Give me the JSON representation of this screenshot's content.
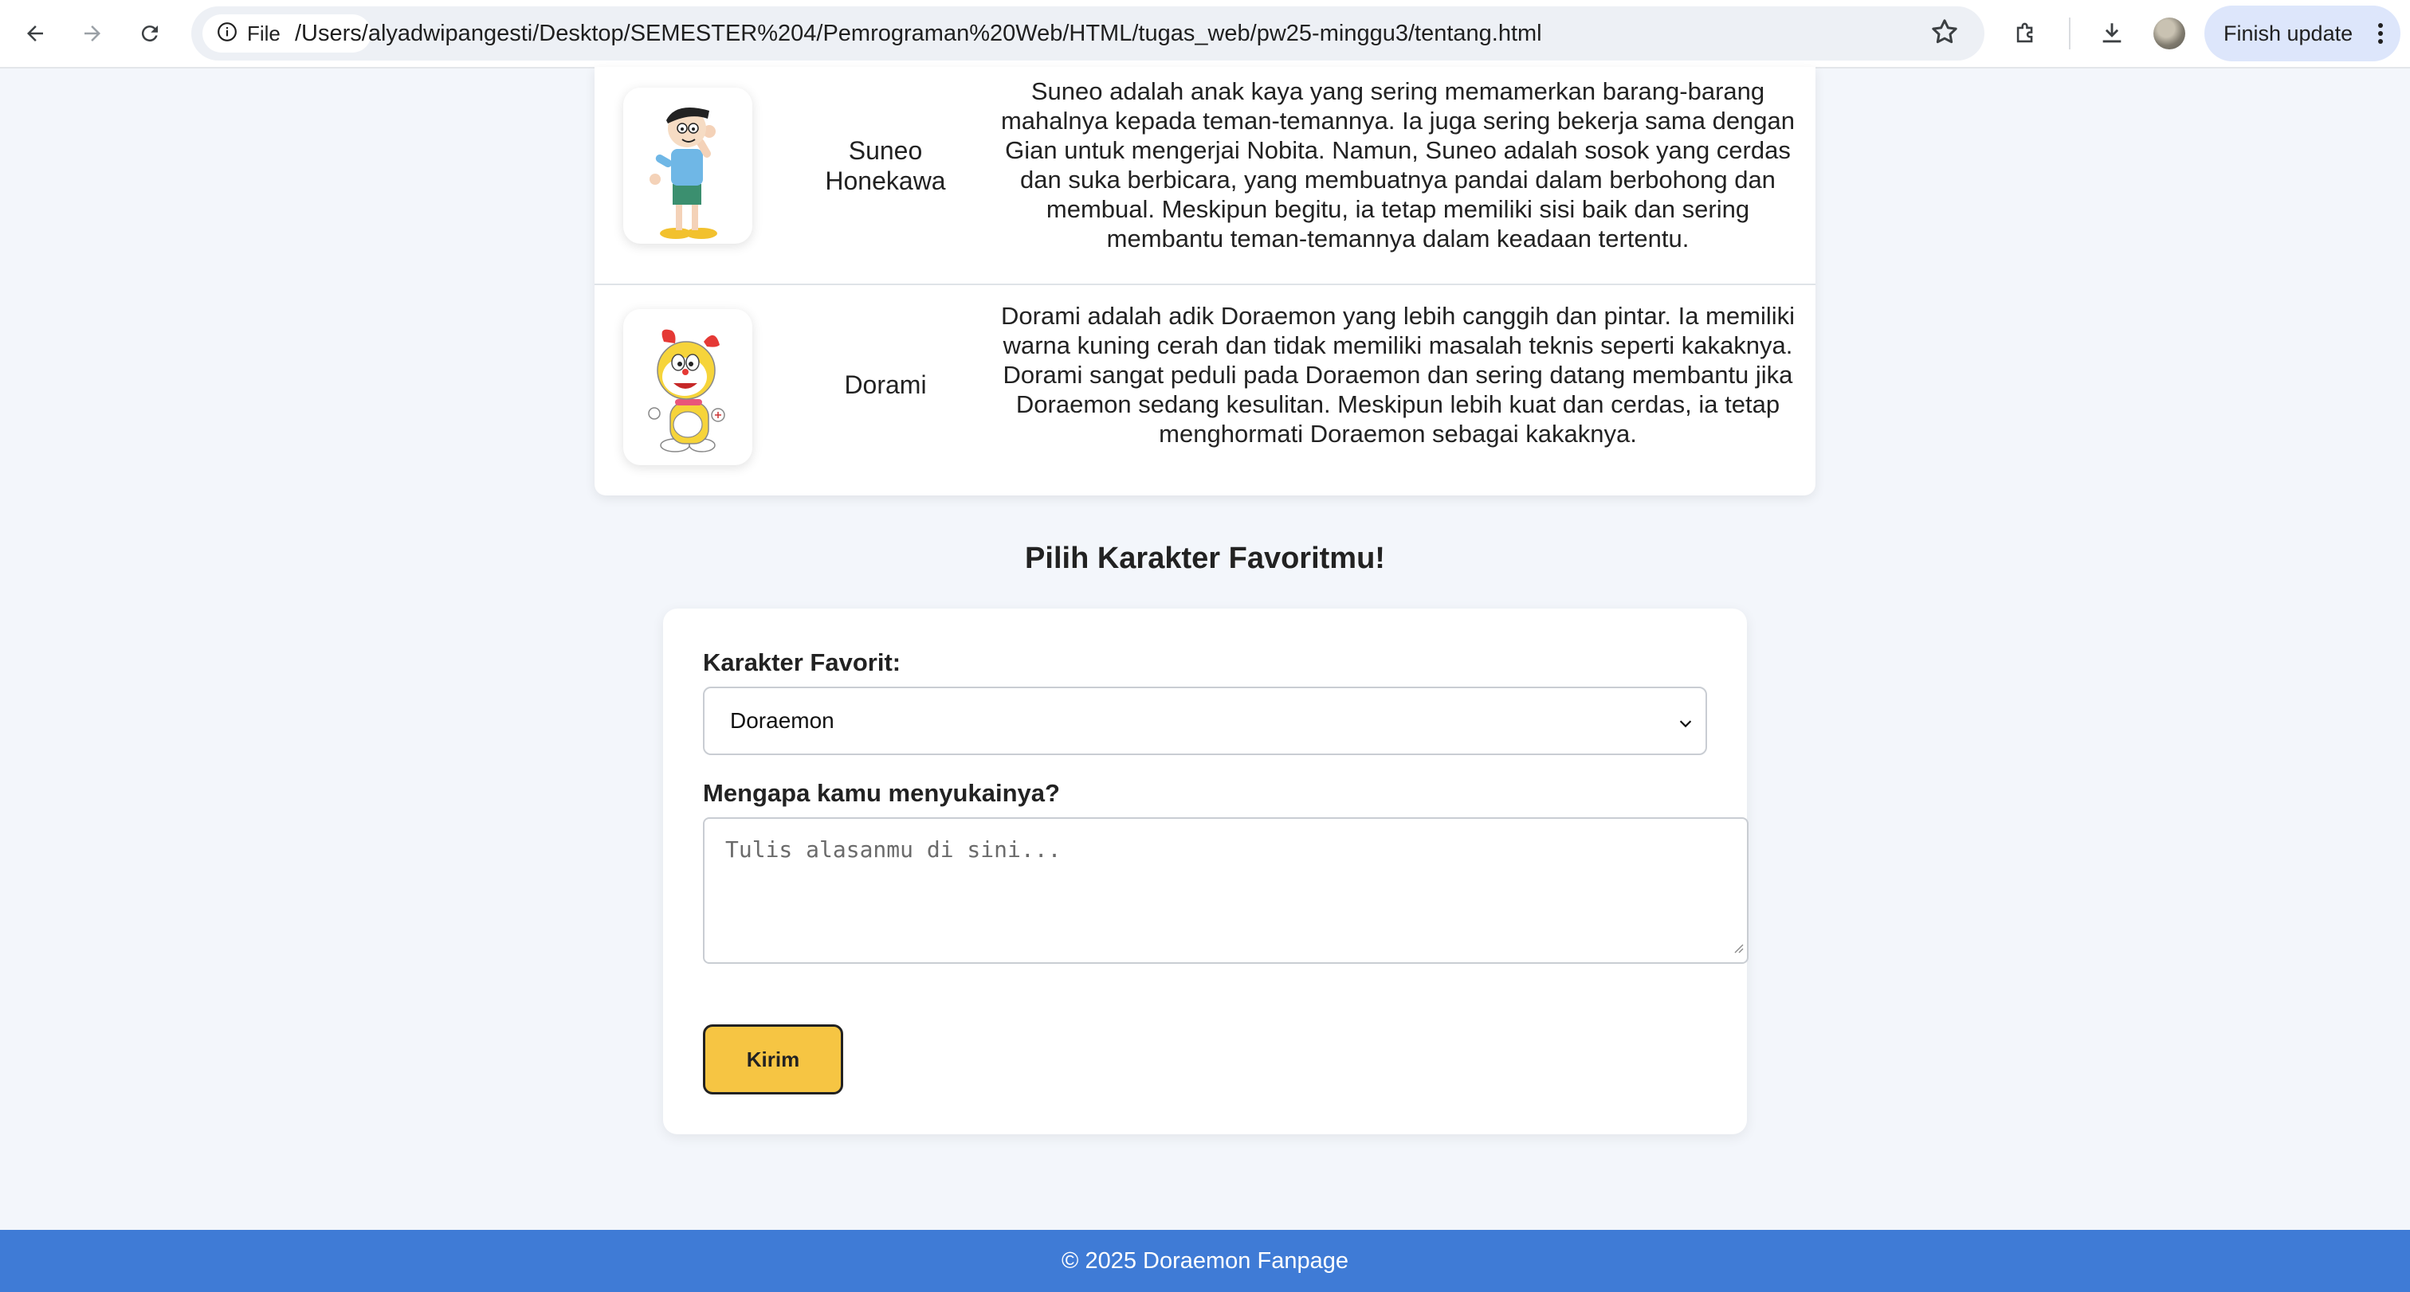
{
  "browser": {
    "chip_label": "File",
    "url": "/Users/alyadwipangesti/Desktop/SEMESTER%204/Pemrograman%20Web/HTML/tugas_web/pw25-minggu3/tentang.html",
    "finish_update": "Finish update"
  },
  "characters": [
    {
      "name": "Suneo Honekawa",
      "description": "Suneo adalah anak kaya yang sering memamerkan barang-barang mahalnya kepada teman-temannya. Ia juga sering bekerja sama dengan Gian untuk mengerjai Nobita. Namun, Suneo adalah sosok yang cerdas dan suka berbicara, yang membuatnya pandai dalam berbohong dan membual. Meskipun begitu, ia tetap memiliki sisi baik dan sering membantu teman-temannya dalam keadaan tertentu."
    },
    {
      "name": "Dorami",
      "description": "Dorami adalah adik Doraemon yang lebih canggih dan pintar. Ia memiliki warna kuning cerah dan tidak memiliki masalah teknis seperti kakaknya. Dorami sangat peduli pada Doraemon dan sering datang membantu jika Doraemon sedang kesulitan. Meskipun lebih kuat dan cerdas, ia tetap menghormati Doraemon sebagai kakaknya."
    }
  ],
  "form": {
    "title": "Pilih Karakter Favoritmu!",
    "favorite_label": "Karakter Favorit:",
    "favorite_value": "Doraemon",
    "reason_label": "Mengapa kamu menyukainya?",
    "reason_placeholder": "Tulis alasanmu di sini...",
    "submit_label": "Kirim"
  },
  "footer": {
    "text": "© 2025 Doraemon Fanpage"
  },
  "colors": {
    "footer": "#3f7bd6",
    "button": "#f6c543",
    "page_bg": "#f3f6fb"
  }
}
